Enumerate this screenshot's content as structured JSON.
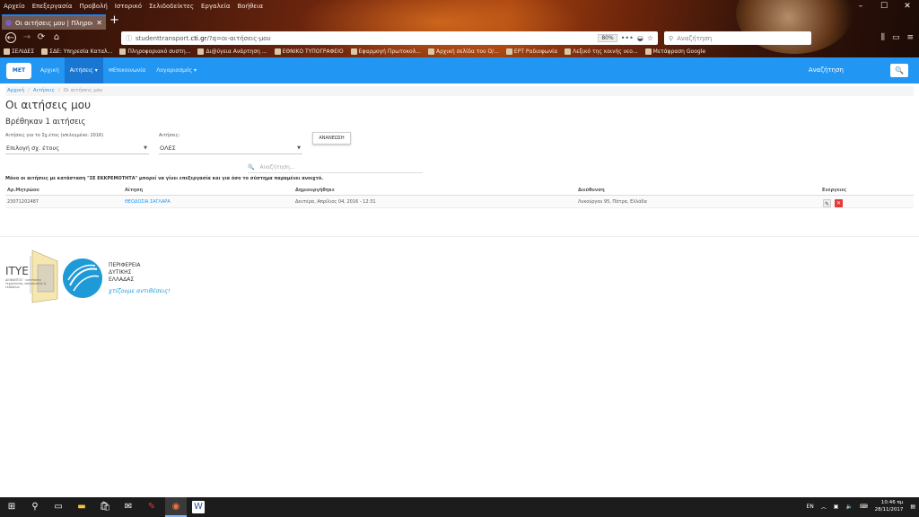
{
  "browser": {
    "menu": [
      "Αρχείο",
      "Επεξεργασία",
      "Προβολή",
      "Ιστορικό",
      "Σελιδοδείκτες",
      "Εργαλεία",
      "Βοήθεια"
    ],
    "tab_title": "Οι αιτήσεις μου | Πληροφορι...",
    "url_prefix": "studenttransport.",
    "url_domain": "cti.gr",
    "url_path": "/?q=οι-αιτήσεις-μου",
    "zoom": "80%",
    "search_placeholder": "Αναζήτηση",
    "bookmarks": [
      "ΣΕΛΙΔΕΣ",
      "ΣΔΕ: Υπηρεσία Καταλ...",
      "Πληροφοριακό συστη...",
      "Δι@ύγεια Ανάρτηση ...",
      "ΕΘΝΙΚΟ ΤΥΠΟΓΡΑΦΕΙΟ",
      "Εφαρμογή Πρωτοκολ...",
      "Αρχική σελίδα του Ο/...",
      "ΕΡΤ Ραδιοφωνία",
      "Λεξικό της κοινής νεο...",
      "Μετάφραση Google"
    ]
  },
  "site": {
    "logo_text": "ΜΕΤ",
    "nav": [
      "Αρχική",
      "Αιτήσεις ▾",
      "✉Επικοινωνία",
      "Λογαριασμός ▾"
    ],
    "search_label": "Αναζήτηση",
    "search_btn": "🔍"
  },
  "breadcrumb": {
    "home": "Αρχική",
    "section": "Αιτήσεις",
    "current": "Οι αιτήσεις μου"
  },
  "page": {
    "title": "Οι αιτήσεις μου",
    "subtitle": "Βρέθηκαν 1 αιτήσεις",
    "year_label": "Αιτήσεις για το Σχ.έτος (επιλεγμένο: 2016)",
    "year_select": "Επιλογή σχ. έτους",
    "type_label": "Αιτήσεις:",
    "type_select": "ΟΛΕΣ",
    "refresh": "ΑΝΑΝΕΩΣΗ",
    "search_placeholder": "Αναζήτηση...",
    "note": "Μόνο οι αιτήσεις με κατάσταση \"ΣΕ ΕΚΚΡΕΜΟΤΗΤΑ\" μπορεί να γίνει επεξεργασία και για όσο το σύστημα παραμένει ανοιχτό."
  },
  "table": {
    "headers": [
      "Αρ.Μητρώου",
      "Αίτηση",
      "Δημιουργήθηκε",
      "Διεύθυνση",
      "Ενέργειες"
    ],
    "rows": [
      {
        "id": "23071202487",
        "name": "ΘΕΟΔΟΣΙΑ ΣΑΓΛΑΡΑ",
        "created": "Δευτέρα, Απρίλιος 04, 2016 - 12:31",
        "address": "Λυκούργου 95, Πάτρα, Ελλάδα"
      }
    ]
  },
  "footer": {
    "itye": "ΙΤΥΕ",
    "itye_sub": "ΔΙΟΦΑΝΤΟΣ · ινστιτούτο τεχνολογίας υπολογιστών & εκδόσεων",
    "region": [
      "ΠΕΡΙΦΕΡΕΙΑ",
      "ΔΥΤΙΚΗΣ",
      "ΕΛΛΑΔΑΣ"
    ],
    "slogan": "χτίζουμε αντιθέσεις!"
  },
  "taskbar": {
    "lang": "EN",
    "time": "10:46 πμ",
    "date": "28/11/2017"
  }
}
